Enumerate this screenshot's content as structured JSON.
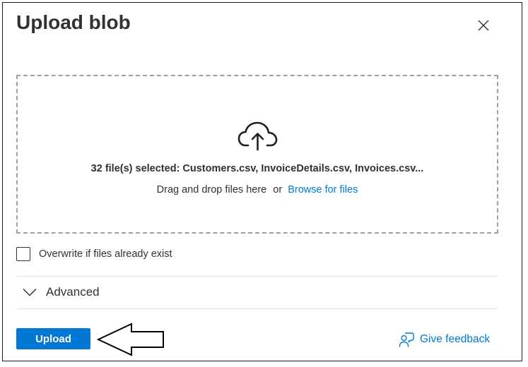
{
  "dialog": {
    "title": "Upload blob",
    "close_icon": "close-icon"
  },
  "dropzone": {
    "icon": "cloud-upload-icon",
    "selected_text": "32 file(s) selected: Customers.csv, InvoiceDetails.csv, Invoices.csv...",
    "drag_text": "Drag and drop files here",
    "or_text": "or",
    "browse_label": "Browse for files"
  },
  "options": {
    "overwrite_label": "Overwrite if files already exist",
    "overwrite_checked": false
  },
  "advanced": {
    "label": "Advanced",
    "icon": "chevron-down-icon"
  },
  "footer": {
    "upload_label": "Upload",
    "feedback_label": "Give feedback",
    "feedback_icon": "feedback-person-icon",
    "annotation": "arrow-left-icon"
  },
  "colors": {
    "accent": "#0078d4",
    "text": "#323130",
    "border_dashed": "#a19f9d",
    "divider": "#e1dfdd"
  }
}
